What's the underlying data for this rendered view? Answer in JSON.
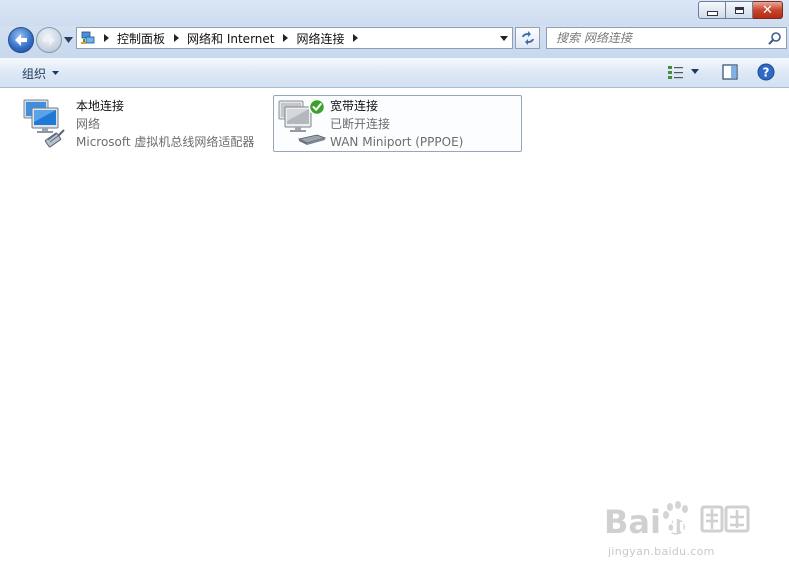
{
  "window": {
    "caption_buttons": [
      "minimize",
      "maximize",
      "close"
    ]
  },
  "address_bar": {
    "breadcrumbs": [
      "控制面板",
      "网络和 Internet",
      "网络连接"
    ],
    "folder_icon": "network-connections-icon"
  },
  "search": {
    "placeholder": "搜索 网络连接"
  },
  "command_bar": {
    "organize_label": "组织"
  },
  "connections": [
    {
      "name": "本地连接",
      "status": "网络",
      "device": "Microsoft 虚拟机总线网络适配器",
      "icon": "lan-connection-icon"
    },
    {
      "name": "宽带连接",
      "status": "已断开连接",
      "device": "WAN Miniport (PPPOE)",
      "icon": "broadband-connection-icon",
      "selected": true
    }
  ],
  "watermark": {
    "url": "jingyan.baidu.com",
    "logo": "baidu-jingyan-logo"
  },
  "colors": {
    "accent": "#2f6bc4",
    "close_red": "#c8452d",
    "check_green": "#3aa12a"
  }
}
